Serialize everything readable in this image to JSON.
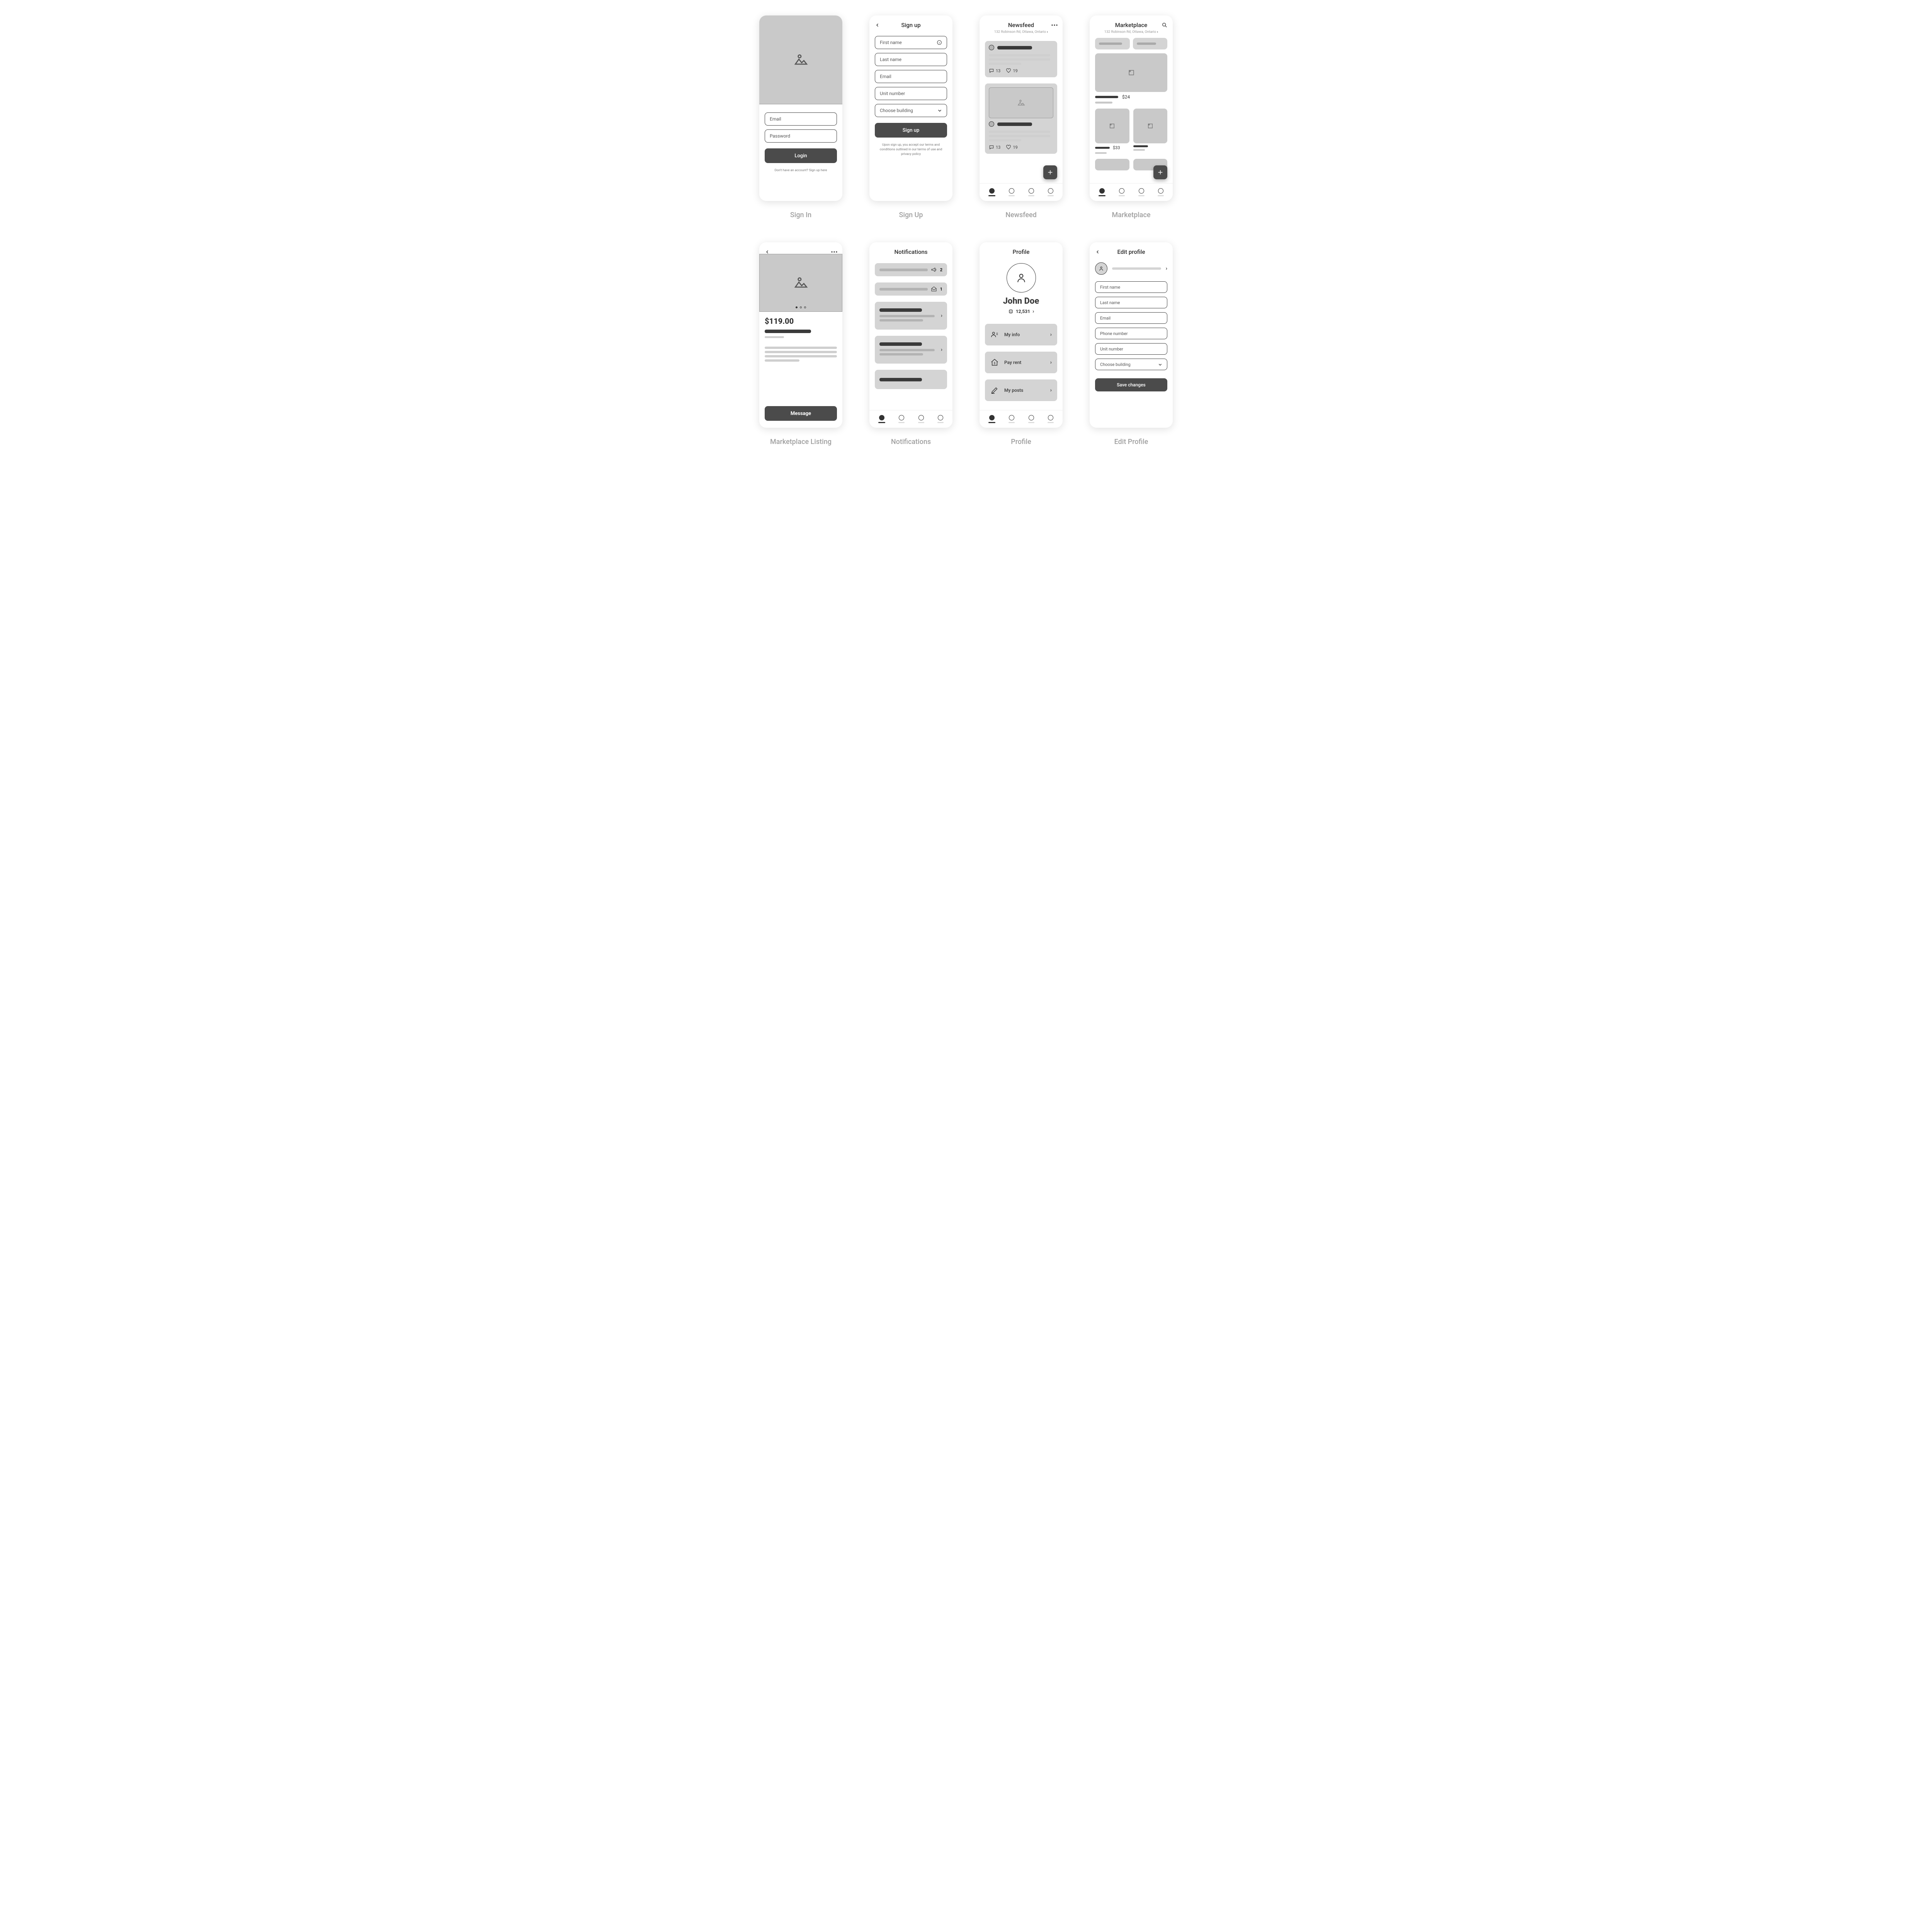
{
  "screens": {
    "signin": {
      "label": "Sign In",
      "email_ph": "Email",
      "password_ph": "Password",
      "login_btn": "Login",
      "helper": "Don't have an account? Sign up here"
    },
    "signup": {
      "label": "Sign Up",
      "title": "Sign up",
      "first_name_ph": "First name",
      "last_name_ph": "Last name",
      "email_ph": "Email",
      "unit_ph": "Unit number",
      "building_ph": "Choose building",
      "submit_btn": "Sign up",
      "helper": "Upon sign up, you accept our terms and conditions outlined in our terms of use and privacy policy"
    },
    "newsfeed": {
      "label": "Newsfeed",
      "title": "Newsfeed",
      "address": "132 Robinson Rd, Ottawa, Ontario",
      "post1": {
        "comments": "13",
        "likes": "19"
      },
      "post2": {
        "comments": "13",
        "likes": "19"
      }
    },
    "marketplace": {
      "label": "Marketplace",
      "title": "Marketplace",
      "address": "132 Robinson Rd, Ottawa, Ontario",
      "item1_price": "$24",
      "item2_price": "$33"
    },
    "listing": {
      "label": "Marketplace Listing",
      "price": "$119.00",
      "message_btn": "Message"
    },
    "notifications": {
      "label": "Notifications",
      "title": "Notifications",
      "badge1": "2",
      "badge2": "1"
    },
    "profile": {
      "label": "Profile",
      "title": "Profile",
      "name": "John Doe",
      "points": "12,531",
      "rows": {
        "info": "My info",
        "rent": "Pay rent",
        "posts": "My posts"
      }
    },
    "edit": {
      "label": "Edit Profile",
      "title": "Edit profile",
      "first_name_ph": "First name",
      "last_name_ph": "Last name",
      "email_ph": "Email",
      "phone_ph": "Phone number",
      "unit_ph": "Unit number",
      "building_ph": "Choose building",
      "save_btn": "Save changes"
    }
  }
}
